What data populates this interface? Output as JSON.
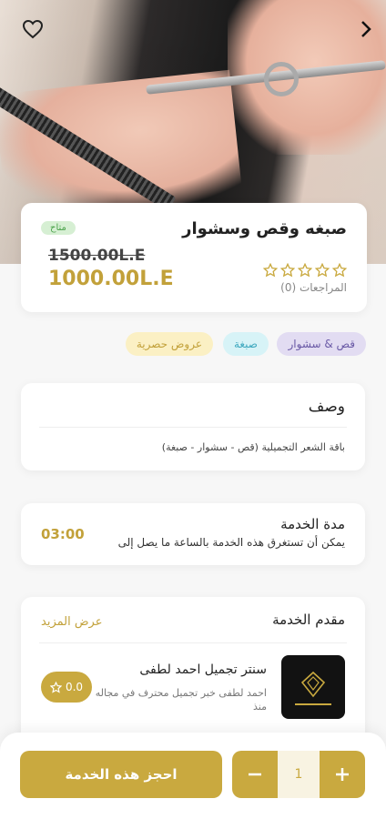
{
  "service": {
    "title": "صبغه وقص وسشوار",
    "availability": "متاح",
    "old_price": "1500.00L.E",
    "new_price": "1000.00L.E",
    "reviews": "المراجعات (0)"
  },
  "chips": [
    "قص & سشوار",
    "صبغة",
    "عروض حصرية"
  ],
  "description": {
    "title": "وصف",
    "text": "باقة الشعر التجميلية (قص - سشوار - صبغة)"
  },
  "duration": {
    "title": "مدة الخدمة",
    "subtitle": "يمكن أن تستغرق هذه الخدمة بالساعة ما يصل إلى",
    "time": "03:00"
  },
  "provider": {
    "section_title": "مقدم الخدمة",
    "more_link": "عرض المزيد",
    "name": "سنتر تجميل احمد لطفى",
    "description": "احمد لطفى خبر تجميل محترف في مجاله منذ",
    "rating": "0.0"
  },
  "booking": {
    "button_label": "احجز هذه الخدمة",
    "quantity": "1"
  },
  "colors": {
    "accent": "#c9a93f",
    "available_bg": "#d6efd3"
  },
  "icons": [
    "heart-icon",
    "chevron-right-icon",
    "star-icon",
    "plus-icon",
    "minus-icon"
  ]
}
